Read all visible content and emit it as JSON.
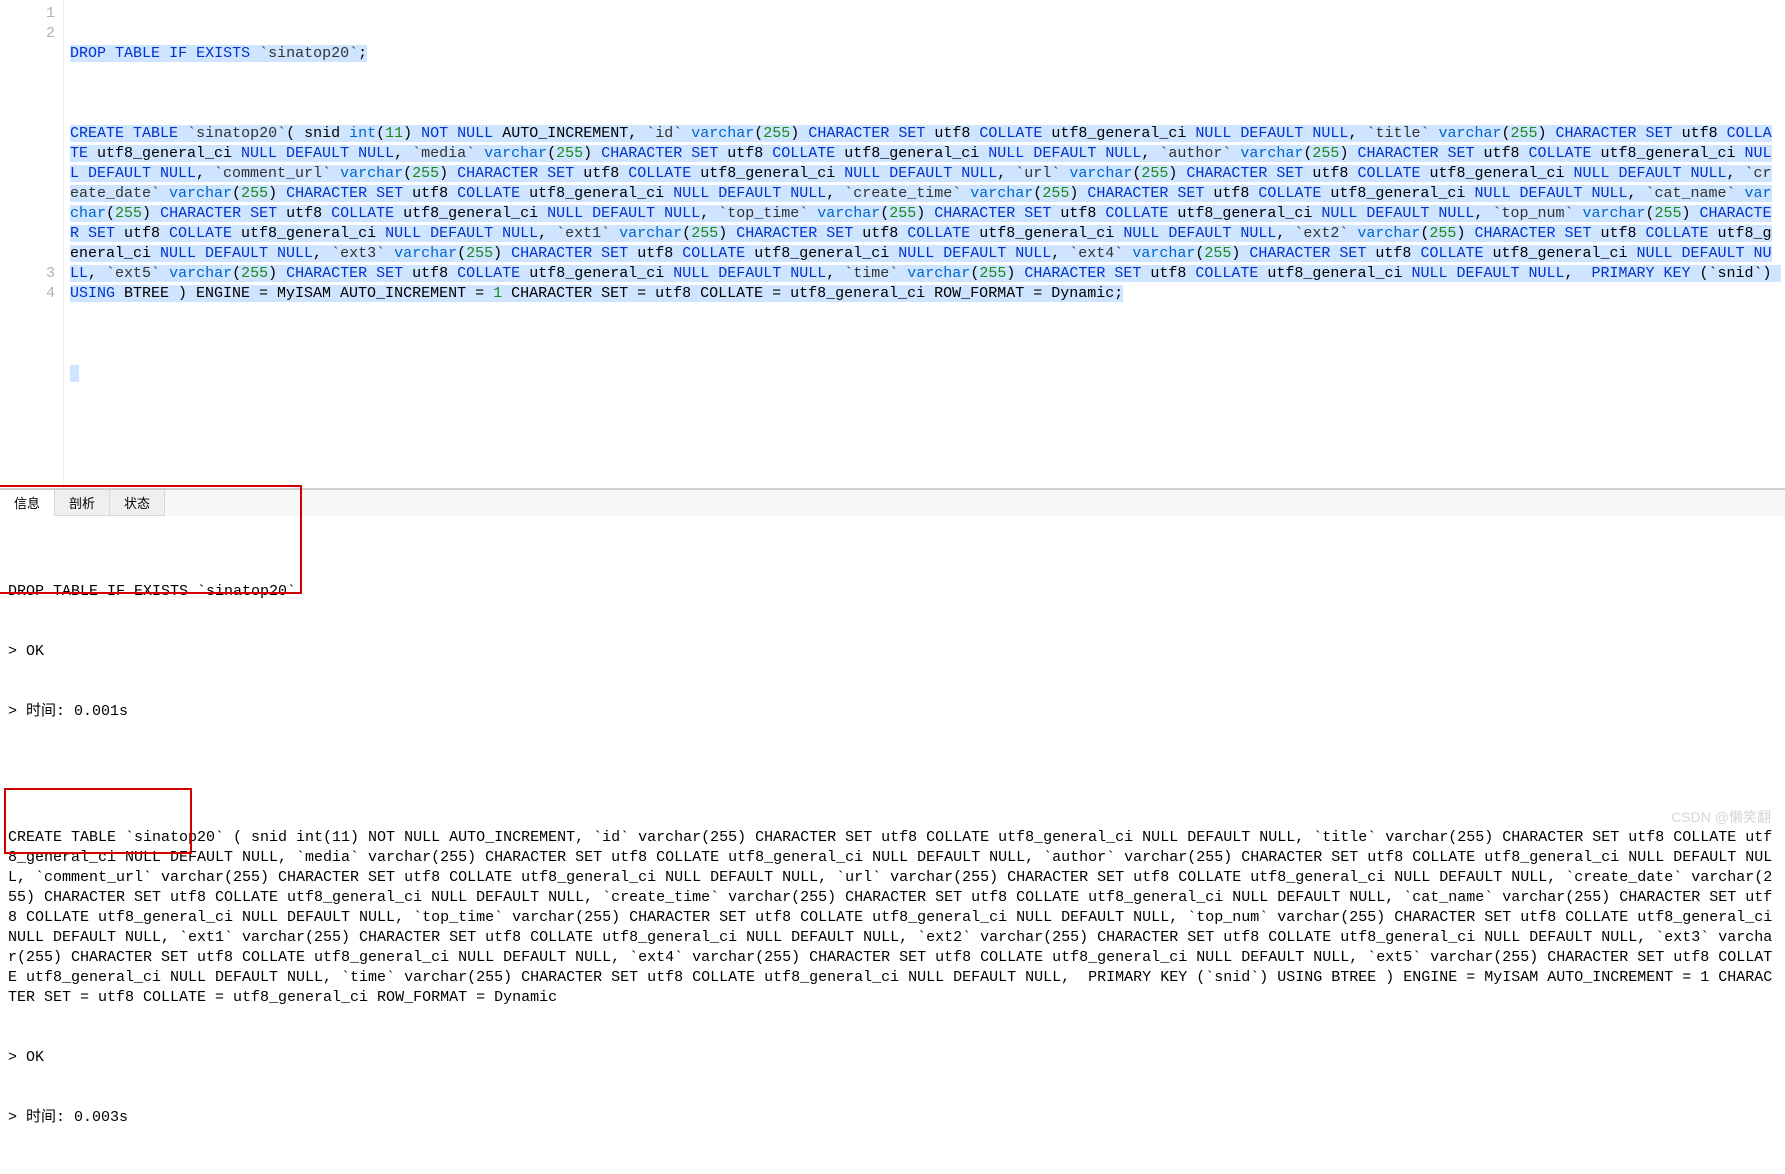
{
  "editor": {
    "lines": [
      "1",
      "2",
      "3",
      "4"
    ],
    "l1": {
      "drop": "DROP",
      "table": "TABLE",
      "ifx": "IF",
      "exists": "EXISTS",
      "tbl": "`sinatop20`",
      "sc": ";"
    },
    "l2": {
      "create": "CREATE",
      "table": "TABLE",
      "tbl": "`sinatop20`",
      "op": "( snid ",
      "intw": "int",
      "paren1": "(",
      "n11": "11",
      "paren2": ") ",
      "nn": "NOT NULL",
      "ai": " AUTO_INCREMENT, ",
      "id": "`id`",
      "sp": " ",
      "vc": "varchar",
      "p255o": "(",
      "n255": "255",
      "p255c": ") ",
      "cs": "CHARACTER SET",
      "u8": " utf8 ",
      "col": "COLLATE",
      "gc": " utf8_general_ci ",
      "ndn": "NULL DEFAULT NULL",
      "cm": ", ",
      "title": "`title`",
      "media": "`media`",
      "author": "`author`",
      "curl": "`comment_url`",
      "url": "`url`",
      "cdate": "`create_date`",
      "ctime": "`create_time`",
      "cname": "`cat_name`",
      "ttime": "`top_time`",
      "tnum": "`top_num`",
      "e1": "`ext1`",
      "e2": "`ext2`",
      "e3": "`ext3`",
      "e4": "`ext4`",
      "e5": "`ext5`",
      "time": "`time`",
      "pk": "PRIMARY KEY",
      "pktail": " (`snid`) ",
      "using": "USING",
      "btree": " BTREE ) ",
      "eng": "ENGINE = MyISAM AUTO_INCREMENT = ",
      "one": "1",
      "tail": " CHARACTER SET = utf8 COLLATE = utf8_general_ci ROW_FORMAT = Dynamic;",
      "dflt": "DEFAULT",
      "nul": "NULL",
      "null2": " NULL"
    }
  },
  "tabs": {
    "t1": "信息",
    "t2": "剖析",
    "t3": "状态"
  },
  "results": {
    "r1": "DROP TABLE IF EXISTS `sinatop20`",
    "r2": "> OK",
    "r3": "> 时间: 0.001s",
    "r4": "CREATE TABLE `sinatop20` ( snid int(11) NOT NULL AUTO_INCREMENT, `id` varchar(255) CHARACTER SET utf8 COLLATE utf8_general_ci NULL DEFAULT NULL, `title` varchar(255) CHARACTER SET utf8 COLLATE utf8_general_ci NULL DEFAULT NULL, `media` varchar(255) CHARACTER SET utf8 COLLATE utf8_general_ci NULL DEFAULT NULL, `author` varchar(255) CHARACTER SET utf8 COLLATE utf8_general_ci NULL DEFAULT NULL, `comment_url` varchar(255) CHARACTER SET utf8 COLLATE utf8_general_ci NULL DEFAULT NULL, `url` varchar(255) CHARACTER SET utf8 COLLATE utf8_general_ci NULL DEFAULT NULL, `create_date` varchar(255) CHARACTER SET utf8 COLLATE utf8_general_ci NULL DEFAULT NULL, `create_time` varchar(255) CHARACTER SET utf8 COLLATE utf8_general_ci NULL DEFAULT NULL, `cat_name` varchar(255) CHARACTER SET utf8 COLLATE utf8_general_ci NULL DEFAULT NULL, `top_time` varchar(255) CHARACTER SET utf8 COLLATE utf8_general_ci NULL DEFAULT NULL, `top_num` varchar(255) CHARACTER SET utf8 COLLATE utf8_general_ci NULL DEFAULT NULL, `ext1` varchar(255) CHARACTER SET utf8 COLLATE utf8_general_ci NULL DEFAULT NULL, `ext2` varchar(255) CHARACTER SET utf8 COLLATE utf8_general_ci NULL DEFAULT NULL, `ext3` varchar(255) CHARACTER SET utf8 COLLATE utf8_general_ci NULL DEFAULT NULL, `ext4` varchar(255) CHARACTER SET utf8 COLLATE utf8_general_ci NULL DEFAULT NULL, `ext5` varchar(255) CHARACTER SET utf8 COLLATE utf8_general_ci NULL DEFAULT NULL, `time` varchar(255) CHARACTER SET utf8 COLLATE utf8_general_ci NULL DEFAULT NULL,  PRIMARY KEY (`snid`) USING BTREE ) ENGINE = MyISAM AUTO_INCREMENT = 1 CHARACTER SET = utf8 COLLATE = utf8_general_ci ROW_FORMAT = Dynamic",
    "r5": "> OK",
    "r6": "> 时间: 0.003s"
  },
  "watermark": "CSDN @懒笑翻"
}
